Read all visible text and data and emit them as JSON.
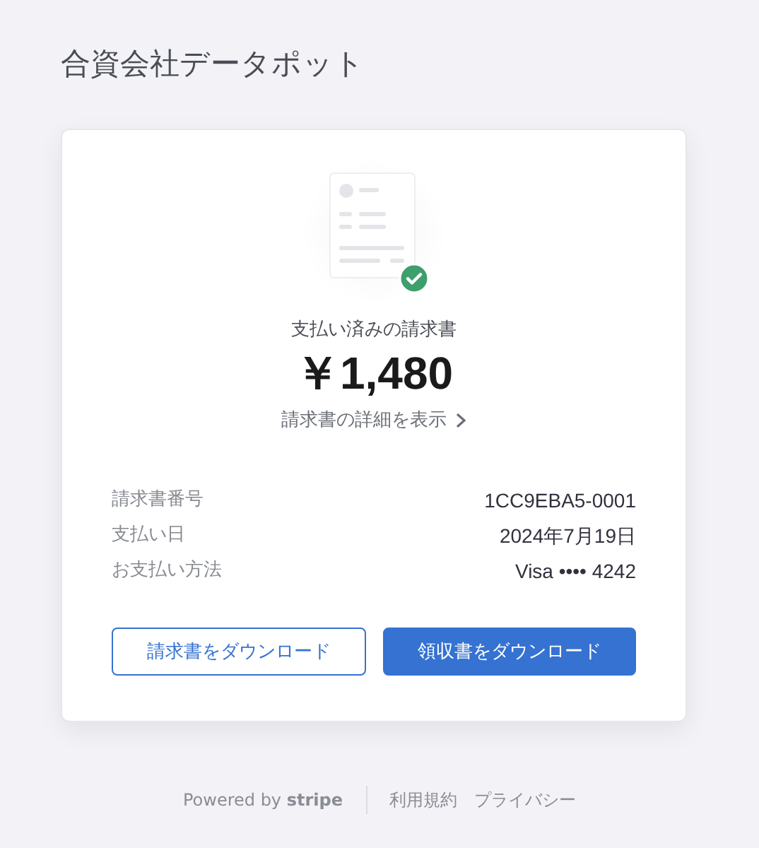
{
  "merchant": {
    "name": "合資会社データポット"
  },
  "invoice": {
    "status": "支払い済みの請求書",
    "amount": "￥1,480",
    "details_link": "請求書の詳細を表示",
    "paid": true
  },
  "summary": [
    {
      "label": "請求書番号",
      "value": "1CC9EBA5-0001"
    },
    {
      "label": "支払い日",
      "value": "2024年7月19日"
    },
    {
      "label": "お支払い方法",
      "value": "Visa •••• 4242"
    }
  ],
  "buttons": [
    {
      "label": "請求書をダウンロード",
      "kind": "secondary"
    },
    {
      "label": "領収書をダウンロード",
      "kind": "primary"
    }
  ],
  "footer": {
    "powered_by": "Powered by **stripe**",
    "links": [
      "利用規約",
      "プライバシー"
    ]
  }
}
